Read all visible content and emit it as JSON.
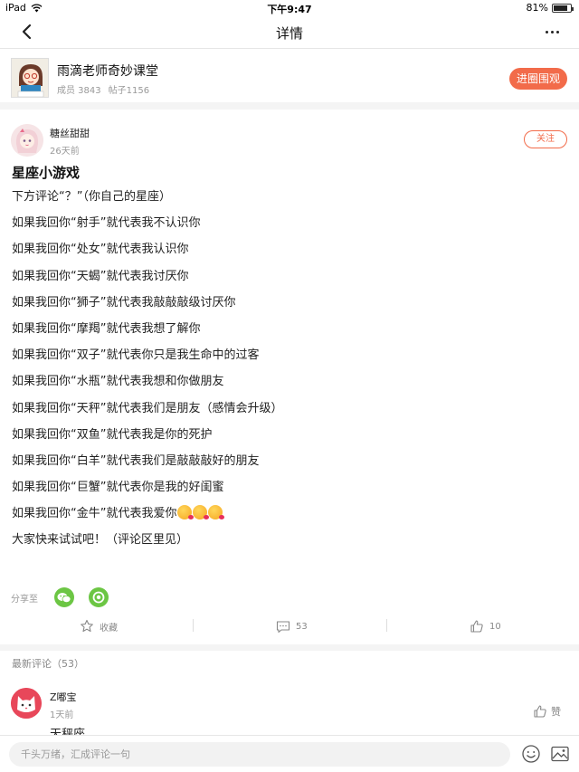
{
  "status_bar": {
    "device": "iPad",
    "time": "下午9:47",
    "battery": "81%",
    "battery_level": 0.81
  },
  "nav": {
    "title": "详情",
    "back_icon": "chevron-left-icon",
    "more_icon": "more-dots-icon"
  },
  "circle": {
    "name": "雨滴老师奇妙课堂",
    "members": "成员 3843",
    "posts": "帖子1156",
    "join_label": "进圈围观"
  },
  "post": {
    "author": "糖丝甜甜",
    "time": "26天前",
    "follow_label": "关注",
    "title": "星座小游戏",
    "lines": [
      "下方评论“？”（你自己的星座）",
      "如果我回你“射手”就代表我不认识你",
      "如果我回你“处女”就代表我认识你",
      "如果我回你“天蝎”就代表我讨厌你",
      "如果我回你“狮子”就代表我敲敲敲级讨厌你",
      "如果我回你“摩羯”就代表我想了解你",
      "如果我回你“双子”就代表你只是我生命中的过客",
      "如果我回你“水瓶”就代表我想和你做朋友",
      "如果我回你“天秤”就代表我们是朋友（感情会升级）",
      "如果我回你“双鱼”就代表我是你的死护",
      "如果我回你“白羊”就代表我们是敲敲敲好的朋友",
      "如果我回你“巨蟹”就代表你是我的好闺蜜",
      "如果我回你“金牛”就代表我爱你",
      "大家快来试试吧！（评论区里见）"
    ],
    "share_label": "分享至",
    "actions": {
      "favorite": "收藏",
      "comments": "53",
      "likes": "10"
    }
  },
  "comments": {
    "title": "最新评论（53）",
    "items": [
      {
        "user": "Z嘟宝",
        "time": "1天前",
        "text": "天秤座",
        "like_label": "赞"
      }
    ]
  },
  "bottom": {
    "input_placeholder": "千头万绪，汇成评论一句"
  }
}
